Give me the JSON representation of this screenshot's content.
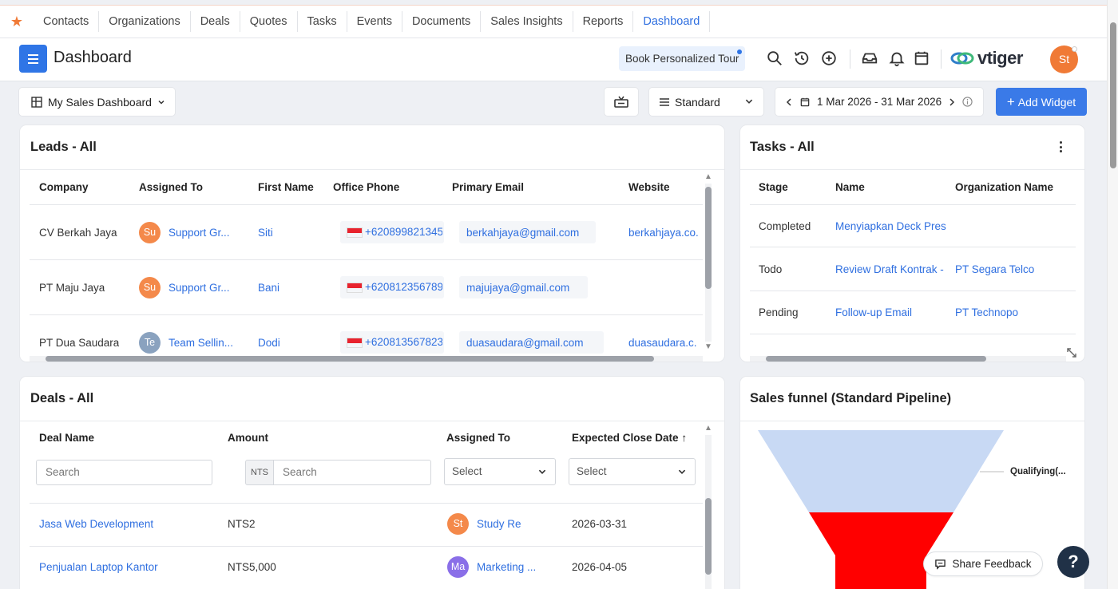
{
  "nav": {
    "items": [
      "Contacts",
      "Organizations",
      "Deals",
      "Quotes",
      "Tasks",
      "Events",
      "Documents",
      "Sales Insights",
      "Reports",
      "Dashboard"
    ],
    "active": "Dashboard"
  },
  "header": {
    "title": "Dashboard",
    "tour_label": "Book Personalized Tour",
    "brand": "vtiger",
    "user_initials": "St"
  },
  "toolbar": {
    "dashboard_name": "My Sales Dashboard",
    "view_mode": "Standard",
    "date_range": "1 Mar 2026 - 31 Mar 2026",
    "add_widget_label": "Add Widget"
  },
  "leads": {
    "title": "Leads - All",
    "columns": [
      "Company",
      "Assigned To",
      "First Name",
      "Office Phone",
      "Primary Email",
      "Website"
    ],
    "rows": [
      {
        "company": "CV Berkah Jaya",
        "initials": "Su",
        "assigned": "Support Gr...",
        "first_name": "Siti",
        "phone": "+620899821345",
        "email": "berkahjaya@gmail.com",
        "website": "berkahjaya.co."
      },
      {
        "company": "PT Maju Jaya",
        "initials": "Su",
        "assigned": "Support Gr...",
        "first_name": "Bani",
        "phone": "+620812356789",
        "email": "majujaya@gmail.com",
        "website": ""
      },
      {
        "company": "PT Dua Saudara",
        "initials": "Te",
        "assigned": "Team Sellin...",
        "first_name": "Dodi",
        "phone": "+620813567823",
        "email": "duasaudara@gmail.com",
        "website": "duasaudara.c."
      }
    ]
  },
  "tasks": {
    "title": "Tasks - All",
    "columns": [
      "Stage",
      "Name",
      "Organization Name"
    ],
    "rows": [
      {
        "stage": "Completed",
        "name": "Menyiapkan Deck Pres",
        "org": ""
      },
      {
        "stage": "Todo",
        "name": "Review Draft Kontrak -",
        "org": "PT Segara Telco"
      },
      {
        "stage": "Pending",
        "name": "Follow-up Email",
        "org": "PT Technopo"
      }
    ]
  },
  "deals": {
    "title": "Deals - All",
    "columns": [
      "Deal Name",
      "Amount",
      "Assigned To",
      "Expected Close Date"
    ],
    "sort_indicator": "↑",
    "search_placeholder": "Search",
    "currency": "NTS",
    "select_placeholder": "Select",
    "rows": [
      {
        "name": "Jasa Web Development",
        "amount": "NTS2",
        "initials": "St",
        "assigned": "Study Re",
        "close_date": "2026-03-31"
      },
      {
        "name": "Penjualan Laptop Kantor",
        "amount": "NTS5,000",
        "initials": "Ma",
        "assigned": "Marketing ...",
        "close_date": "2026-04-05"
      }
    ]
  },
  "funnel": {
    "title": "Sales funnel (Standard Pipeline)",
    "stage_label": "Qualifying(...",
    "stage_label_2": "",
    "colors": {
      "qualifying": "#c8d9f4",
      "stage2": "#ff0000"
    }
  },
  "footer": {
    "share_feedback": "Share Feedback",
    "help": "?"
  },
  "colors": {
    "accent": "#3a7ae8",
    "link": "#2f6fe0",
    "avatar_orange": "#f4894a",
    "avatar_gray": "#8aa2bf",
    "avatar_purple": "#8a6fe8"
  }
}
